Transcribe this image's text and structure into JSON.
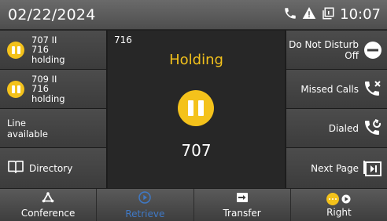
{
  "status_bar": {
    "date": "02/22/2024",
    "time": "10:07",
    "icons": [
      "phone-icon",
      "warning-icon",
      "copy-icon"
    ]
  },
  "left_keys": {
    "call1": {
      "line1": "707 II",
      "line2": "716",
      "line3": "holding"
    },
    "call2": {
      "line1": "709 II",
      "line2": "716",
      "line3": "holding"
    },
    "line": {
      "line1": "Line",
      "line2": "available"
    },
    "directory": {
      "label": "Directory"
    }
  },
  "center": {
    "line_number": "716",
    "status": "Holding",
    "caller": "707"
  },
  "right_keys": {
    "dnd": {
      "line1": "Do Not Disturb",
      "line2": "Off"
    },
    "missed": {
      "label": "Missed Calls"
    },
    "dialed": {
      "label": "Dialed"
    },
    "next_page": {
      "label": "Next Page"
    }
  },
  "softkeys": {
    "conference": "Conference",
    "retrieve": "Retrieve",
    "transfer": "Transfer",
    "right": "Right"
  },
  "colors": {
    "accent": "#f4c21b",
    "disabled": "#3f79c6"
  }
}
